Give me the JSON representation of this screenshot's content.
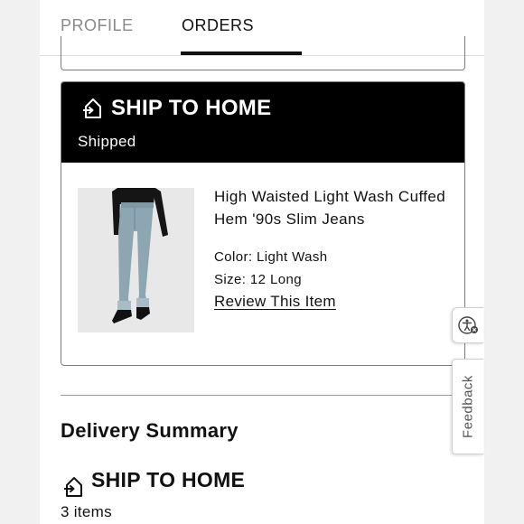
{
  "tabs": {
    "profile": "PROFILE",
    "orders": "ORDERS",
    "active": "orders"
  },
  "shipment": {
    "method": "SHIP TO HOME",
    "status": "Shipped",
    "icon": "home-delivery-icon",
    "item": {
      "name": "High Waisted Light Wash Cuffed Hem '90s Slim Jeans",
      "color_line": "Color: Light Wash",
      "size_line": "Size: 12 Long",
      "review_link": "Review This Item",
      "image": "jeans-product-image"
    }
  },
  "delivery_summary": {
    "title": "Delivery Summary",
    "method": "SHIP TO HOME",
    "items": "3 items"
  },
  "widgets": {
    "accessibility": "accessibility-icon",
    "feedback": "Feedback"
  },
  "colors": {
    "header_bg": "#000000",
    "text": "#111111",
    "muted_tab": "#8a8a8a"
  }
}
